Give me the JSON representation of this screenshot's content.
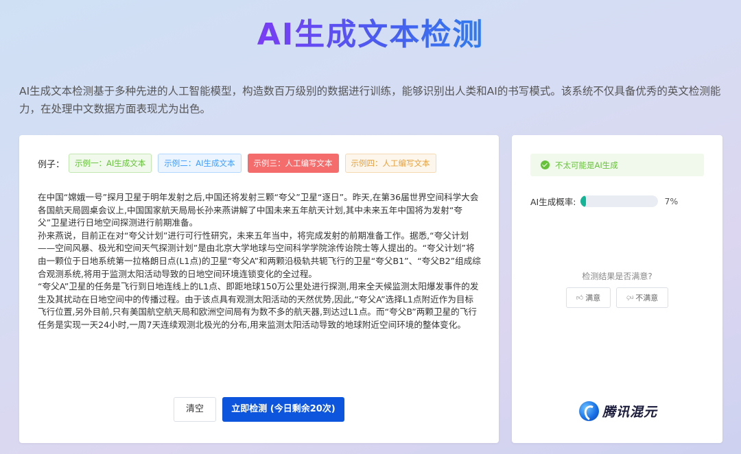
{
  "header": {
    "title": "AI生成文本检测",
    "description": "AI生成文本检测基于多种先进的人工智能模型，构造数百万级别的数据进行训练，能够识别出人类和AI的书写模式。该系统不仅具备优秀的英文检测能力，在处理中文数据方面表现尤为出色。"
  },
  "examples": {
    "label": "例子：",
    "items": [
      {
        "label": "示例一：AI生成文本"
      },
      {
        "label": "示例二：AI生成文本"
      },
      {
        "label": "示例三：人工编写文本"
      },
      {
        "label": "示例四：人工编写文本"
      }
    ]
  },
  "article": {
    "paragraphs": [
      "在中国“嫦娥一号”探月卫星于明年发射之后,中国还将发射三颗“夸父”卫星“逐日”。昨天,在第36届世界空间科学大会各国航天局圆桌会议上,中国国家航天局局长孙来燕讲解了中国未来五年航天计划,其中未来五年中国将为发射“夸父”卫星进行日地空间探测进行前期准备。",
      "孙来燕说，目前正在对“夸父计划”进行可行性研究，未来五年当中，将完成发射的前期准备工作。据悉,“夸父计划——空间风暴、极光和空间天气探测计划”是由北京大学地球与空间科学学院涂传诒院士等人提出的。“夸父计划”将由一颗位于日地系统第一拉格朗日点(L1点)的卫星“夸父A”和两颗沿极轨共轭飞行的卫星“夸父B1”、“夸父B2”组成综合观测系统,将用于监测太阳活动导致的日地空间环境连锁变化的全过程。",
      "“夸父A”卫星的任务是飞行到日地连线上的L1点、即距地球150万公里处进行探测,用来全天候监测太阳爆发事件的发生及其扰动在日地空间中的传播过程。由于该点具有观测太阳活动的天然优势,因此,“夸父A”选择L1点附近作为目标飞行位置,另外目前,只有美国航空航天局和欧洲空间局有为数不多的航天器,到达过L1点。而“夸父B”两颗卫星的飞行任务是实现一天24小时,一周7天连续观测北极光的分布,用来监测太阳活动导致的地球附近空间环境的整体变化。"
    ]
  },
  "actions": {
    "clear_label": "清空",
    "detect_label": "立即检测 (今日剩余20次)"
  },
  "result": {
    "alert_text": "不太可能是AI生成",
    "prob_label": "AI生成概率:",
    "prob_value_text": "7%",
    "prob_fraction": 0.07,
    "satisfaction_question": "检测结果是否满意?",
    "good_label": "满意",
    "bad_label": "不满意"
  },
  "brand": {
    "name": "腾讯混元"
  },
  "colors": {
    "primary_button": "#0d55dc",
    "progress_fill": "#13b596",
    "success": "#67c23a"
  },
  "icons": [
    "check-circle-icon",
    "thumbs-up-icon",
    "thumbs-down-icon",
    "hunyuan-logo-icon"
  ]
}
